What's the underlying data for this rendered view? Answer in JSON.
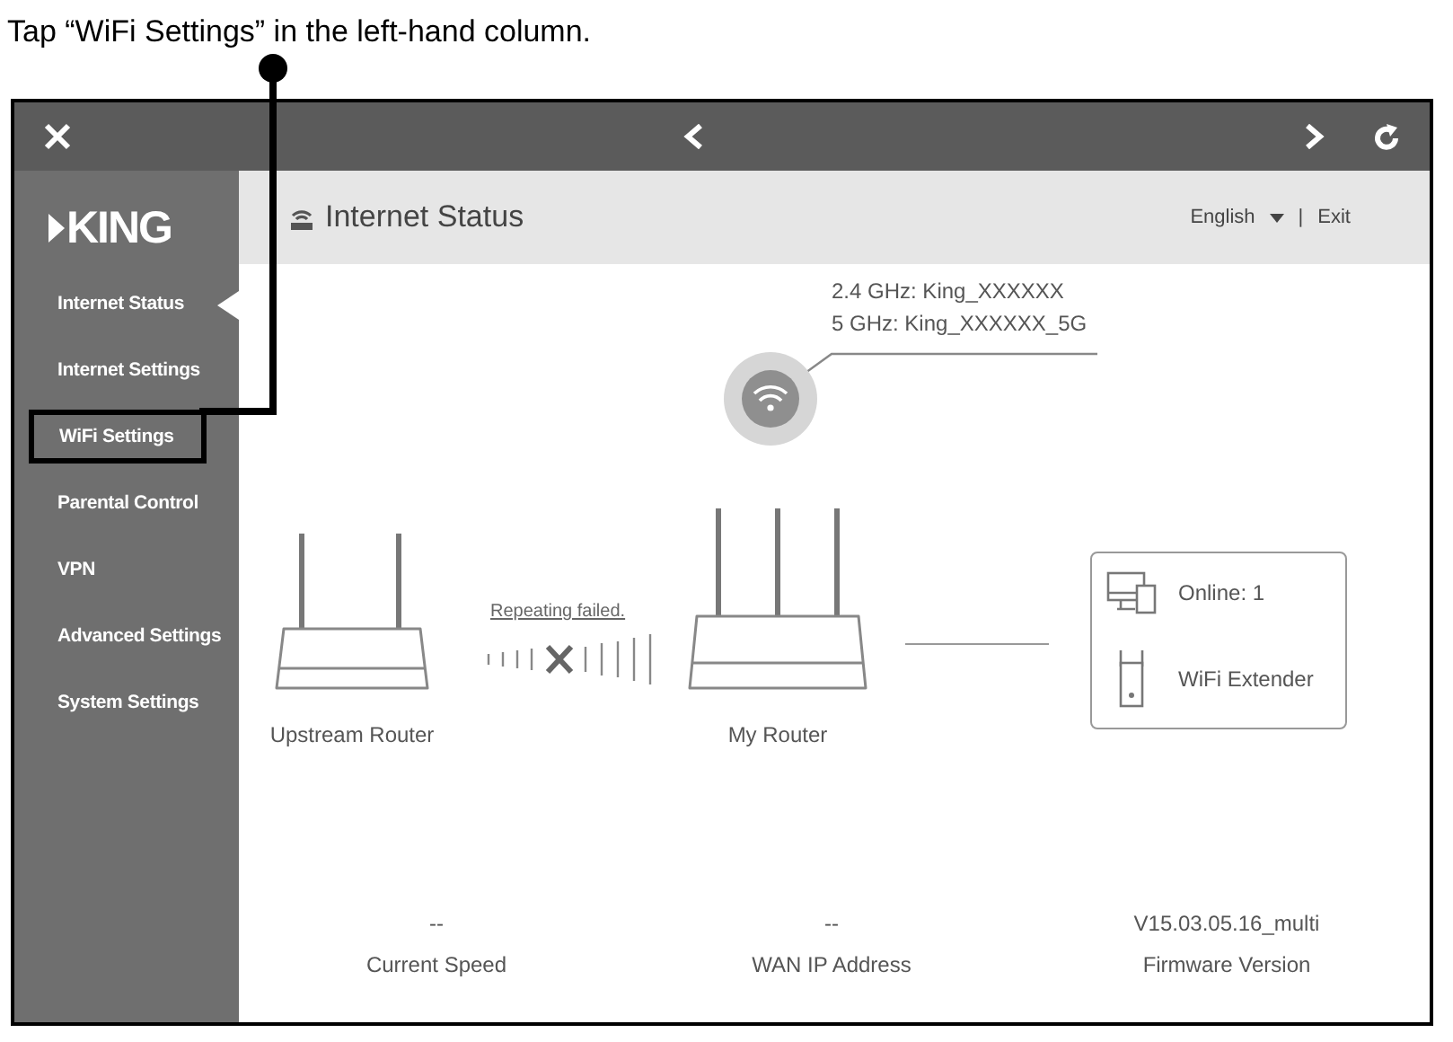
{
  "caption": "Tap “WiFi Settings” in the left-hand column.",
  "app": {
    "logo": "KING",
    "sidebar": {
      "items": [
        {
          "label": "Internet Status",
          "selected": true,
          "highlighted": false
        },
        {
          "label": "Internet Settings",
          "selected": false,
          "highlighted": false
        },
        {
          "label": "WiFi Settings",
          "selected": false,
          "highlighted": true
        },
        {
          "label": "Parental Control",
          "selected": false,
          "highlighted": false
        },
        {
          "label": "VPN",
          "selected": false,
          "highlighted": false
        },
        {
          "label": "Advanced Settings",
          "selected": false,
          "highlighted": false
        },
        {
          "label": "System Settings",
          "selected": false,
          "highlighted": false
        }
      ]
    },
    "header": {
      "title": "Internet Status",
      "language": "English",
      "separator": "|",
      "exit": "Exit"
    },
    "diagram": {
      "ssid_24": "2.4 GHz: King_XXXXXX",
      "ssid_5": "5 GHz: King_XXXXXX_5G",
      "upstream_label": "Upstream Router",
      "repeat_status": "Repeating failed.",
      "my_router_label": "My Router",
      "online": "Online: 1",
      "extender": "WiFi Extender"
    },
    "stats": [
      {
        "value": "--",
        "label": "Current Speed"
      },
      {
        "value": "--",
        "label": "WAN IP Address"
      },
      {
        "value": "V15.03.05.16_multi",
        "label": "Firmware Version"
      }
    ]
  }
}
